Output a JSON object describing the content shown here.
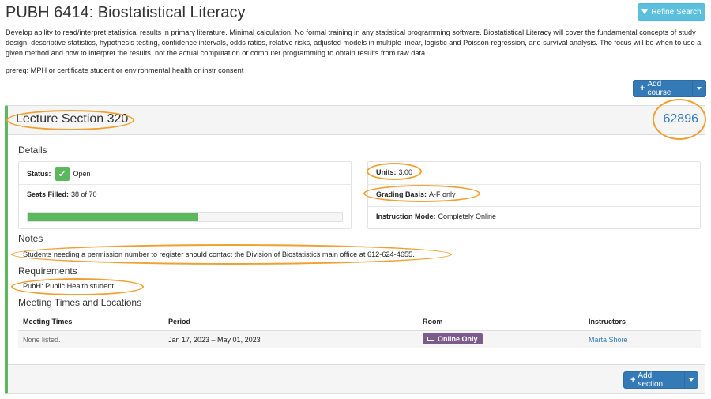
{
  "course": {
    "title": "PUBH 6414: Biostatistical Literacy",
    "description": "Develop ability to read/interpret statistical results in primary literature. Minimal calculation. No formal training in any statistical programming software. Biostatistical Literacy will cover the fundamental concepts of study design, descriptive statistics, hypothesis testing, confidence intervals, odds ratios, relative risks, adjusted models in multiple linear, logistic and Poisson regression, and survival analysis. The focus will be when to use a given method and how to interpret the results, not the actual computation or computer programming to obtain results from raw data.",
    "prereq": "prereq: MPH or certificate student or environmental health or instr consent"
  },
  "toolbar": {
    "refine_label": "Refine Search",
    "add_course_label": "Add course"
  },
  "section": {
    "title": "Lecture Section 320",
    "class_number": "62896",
    "details_heading": "Details",
    "status_label": "Status:",
    "status_value": "Open",
    "seats_label": "Seats Filled:",
    "seats_value": "38 of 70",
    "seats_fraction": 0.543,
    "units_label": "Units:",
    "units_value": "3.00",
    "grading_label": "Grading Basis:",
    "grading_value": "A-F only",
    "mode_label": "Instruction Mode:",
    "mode_value": "Completely Online",
    "notes_heading": "Notes",
    "notes_text": "Students needing a permission number to register should contact the Division of Biostatistics main office at 612-624-4655.",
    "requirements_heading": "Requirements",
    "requirements_text": "PubH: Public Health student",
    "meetings_heading": "Meeting Times and Locations",
    "add_section_label": "Add section"
  },
  "meetings": {
    "columns": [
      "Meeting Times",
      "Period",
      "Room",
      "Instructors"
    ],
    "rows": [
      {
        "times": "None listed.",
        "period": "Jan 17, 2023 – May 01, 2023",
        "room": "Online Only",
        "instructor": "Marta Shore"
      }
    ]
  },
  "colors": {
    "primary": "#337ab7",
    "info": "#5bc0de",
    "success": "#5cb85c",
    "online_badge": "#7b5b8b",
    "annotation_ring": "#f0a030"
  }
}
